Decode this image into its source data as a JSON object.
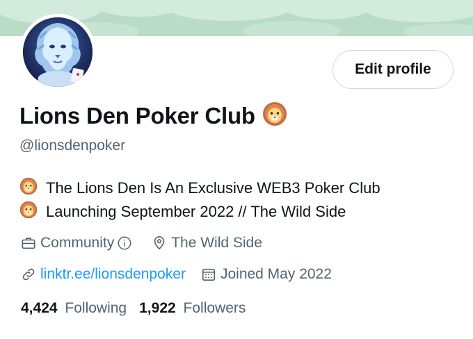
{
  "colors": {
    "banner": "#b9dcc7",
    "link": "#1d9bf0",
    "muted": "#536471",
    "text": "#0f1419"
  },
  "profile": {
    "edit_button": "Edit profile",
    "display_name": "Lions Den Poker Club",
    "handle": "@lionsdenpoker",
    "bio": [
      "The Lions Den Is An Exclusive WEB3 Poker Club",
      "Launching September 2022 // The Wild Side"
    ],
    "category": "Community",
    "location": "The Wild Side",
    "website": "linktr.ee/lionsdenpoker",
    "joined": "Joined May 2022",
    "following_count": "4,424",
    "following_label": "Following",
    "followers_count": "1,922",
    "followers_label": "Followers"
  },
  "icons": {
    "name_emoji": "lion-face-icon",
    "category": "briefcase-icon",
    "info": "info-icon",
    "location": "location-pin-icon",
    "website": "link-icon",
    "joined": "calendar-icon"
  }
}
